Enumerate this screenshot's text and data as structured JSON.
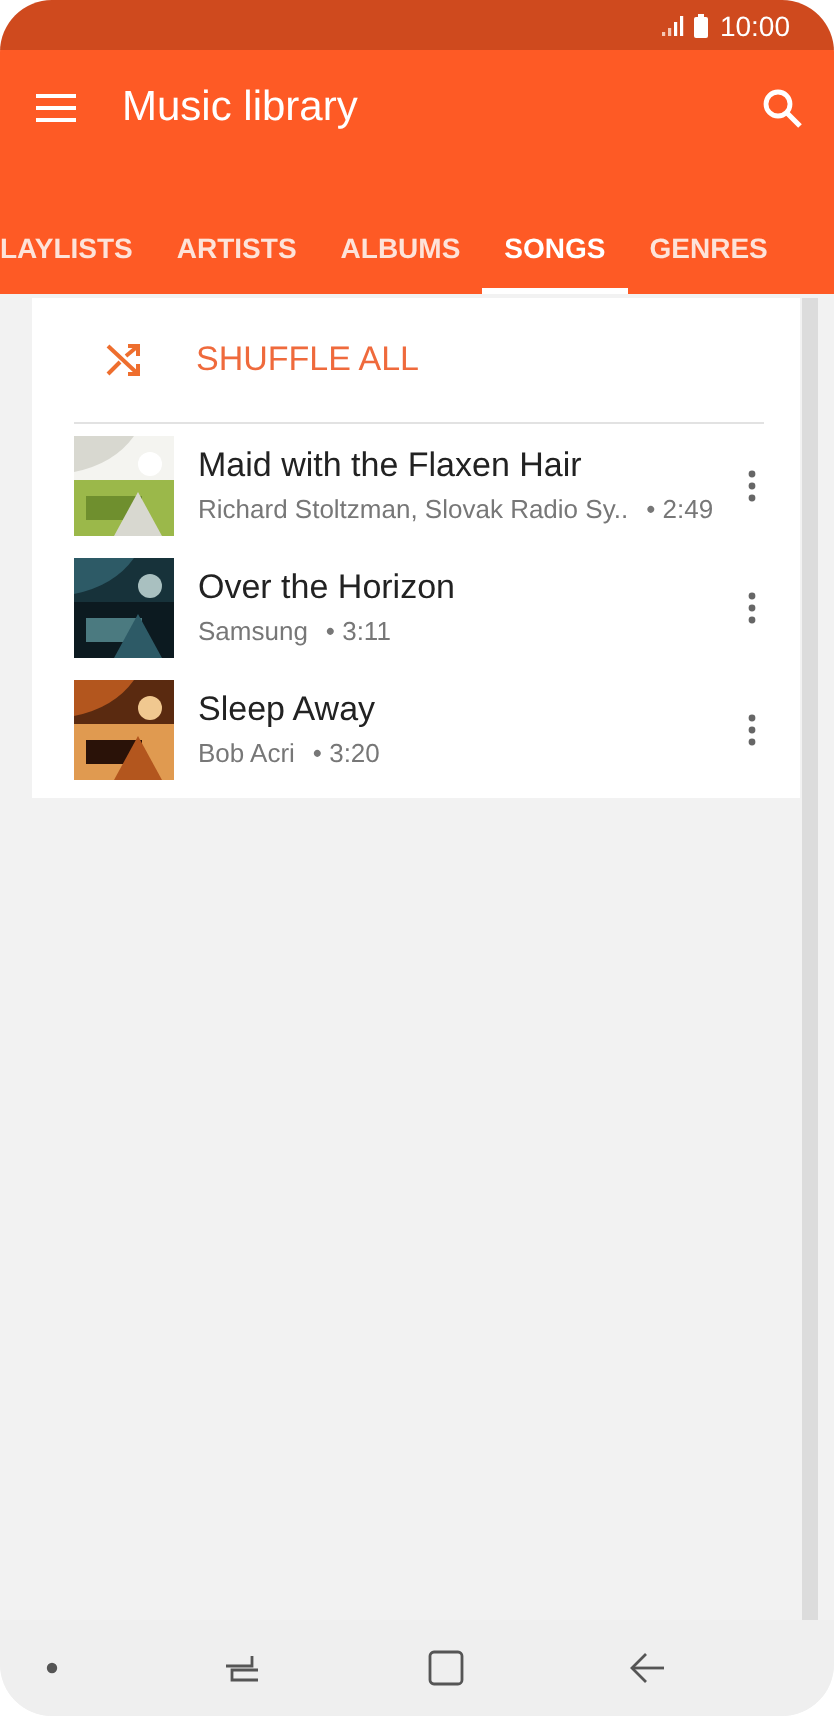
{
  "status_bar": {
    "time": "10:00"
  },
  "app_bar": {
    "title": "Music library"
  },
  "tabs": [
    {
      "label": "LAYLISTS",
      "selected": false
    },
    {
      "label": "ARTISTS",
      "selected": false
    },
    {
      "label": "ALBUMS",
      "selected": false
    },
    {
      "label": "SONGS",
      "selected": true
    },
    {
      "label": "GENRES",
      "selected": false
    }
  ],
  "shuffle": {
    "label": "SHUFFLE ALL"
  },
  "songs": [
    {
      "title": "Maid with the Flaxen Hair",
      "artist": "Richard Stoltzman, Slovak Radio Sy..",
      "duration": "• 2:49"
    },
    {
      "title": "Over the Horizon",
      "artist": "Samsung",
      "duration": "• 3:11"
    },
    {
      "title": "Sleep Away",
      "artist": "Bob Acri",
      "duration": "• 3:20"
    }
  ]
}
